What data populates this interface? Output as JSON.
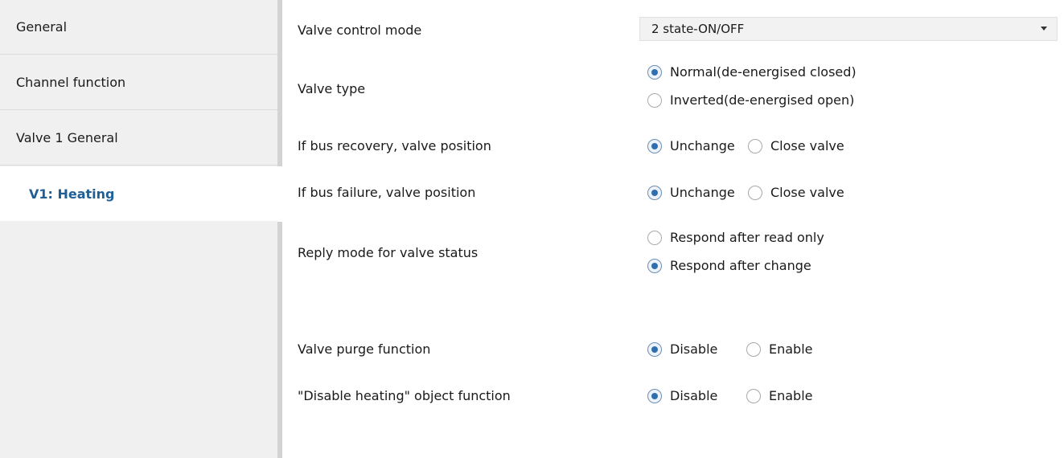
{
  "sidebar": {
    "items": [
      {
        "label": "General"
      },
      {
        "label": "Channel function"
      },
      {
        "label": "Valve 1 General"
      },
      {
        "label": "V1: Heating"
      }
    ]
  },
  "params": {
    "valve_control_mode": {
      "label": "Valve control mode",
      "value": "2 state-ON/OFF"
    },
    "valve_type": {
      "label": "Valve type",
      "options": [
        "Normal(de-energised closed)",
        "Inverted(de-energised open)"
      ],
      "selected": "Normal(de-energised closed)"
    },
    "bus_recovery": {
      "label": "If bus recovery, valve position",
      "options": [
        "Unchange",
        "Close valve"
      ],
      "selected": "Unchange"
    },
    "bus_failure": {
      "label": "If bus failure, valve position",
      "options": [
        "Unchange",
        "Close valve"
      ],
      "selected": "Unchange"
    },
    "reply_mode": {
      "label": "Reply mode for valve status",
      "options": [
        "Respond after read only",
        "Respond after change"
      ],
      "selected": "Respond after change"
    },
    "valve_purge": {
      "label": "Valve purge function",
      "options": [
        "Disable",
        "Enable"
      ],
      "selected": "Disable"
    },
    "disable_heating": {
      "label": "\"Disable heating\" object function",
      "options": [
        "Disable",
        "Enable"
      ],
      "selected": "Disable"
    }
  },
  "colors": {
    "active_tab_text": "#1f5f96",
    "sidebar_bg": "#f0f0f0",
    "radio_dot": "#2f6fb0"
  }
}
